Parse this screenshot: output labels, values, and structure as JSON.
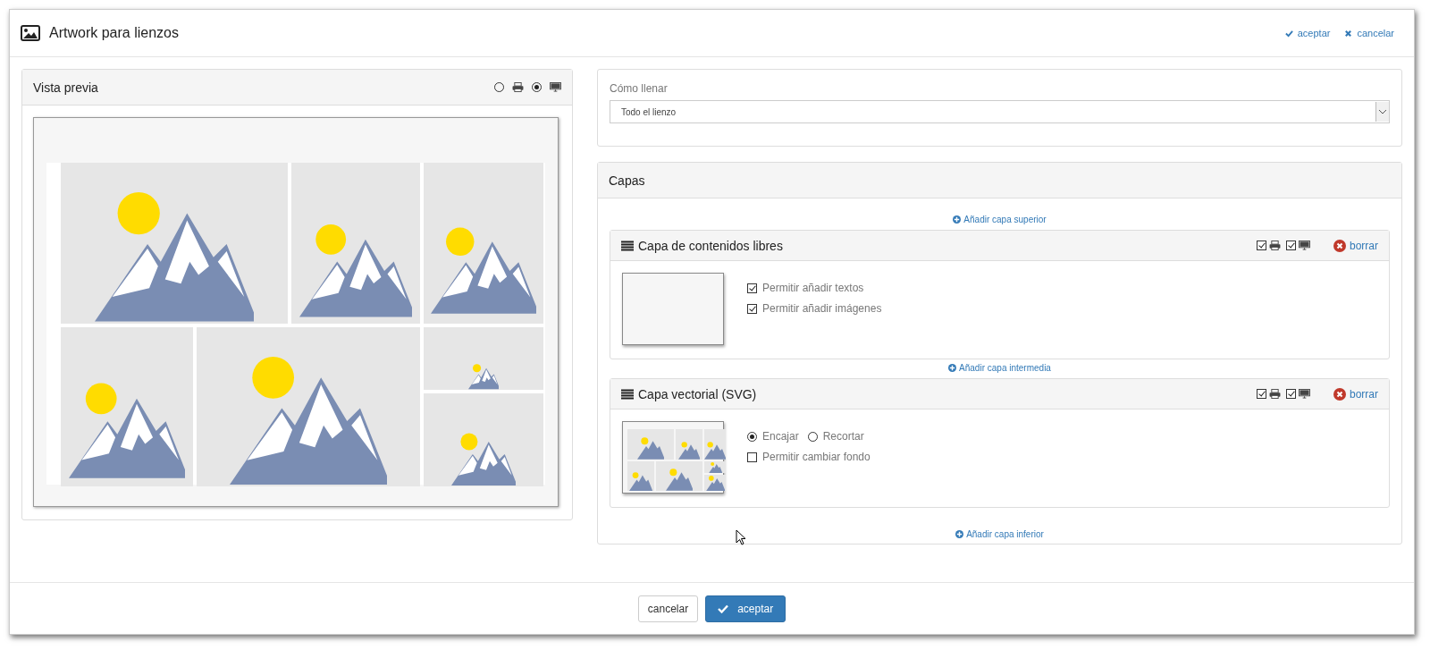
{
  "dialog": {
    "title": "Artwork para lienzos",
    "header_actions": [
      {
        "kind": "accept",
        "label": "aceptar"
      },
      {
        "kind": "cancel",
        "label": "cancelar"
      }
    ]
  },
  "preview": {
    "title": "Vista previa",
    "modes": [
      {
        "kind": "print",
        "selected": false
      },
      {
        "kind": "screen",
        "selected": true
      }
    ]
  },
  "fill": {
    "label": "Cómo llenar",
    "value": "Todo el lienzo"
  },
  "layers_panel": {
    "title": "Capas",
    "add_top": "Añadir capa superior",
    "add_middle": "Añadir capa intermedia",
    "add_bottom": "Añadir capa inferior",
    "layers": [
      {
        "kind": "content",
        "title": "Capa de contenidos libres",
        "print": true,
        "screen": true,
        "delete": "borrar",
        "options": [
          {
            "kind": "checkbox",
            "label": "Permitir añadir textos",
            "checked": true
          },
          {
            "kind": "checkbox",
            "label": "Permitir añadir imágenes",
            "checked": true
          }
        ]
      },
      {
        "kind": "vector",
        "title": "Capa vectorial (SVG)",
        "print": true,
        "screen": true,
        "delete": "borrar",
        "options": [
          {
            "kind": "radios",
            "items": [
              {
                "label": "Encajar",
                "selected": true
              },
              {
                "label": "Recortar",
                "selected": false
              }
            ]
          },
          {
            "kind": "checkbox",
            "label": "Permitir cambiar fondo",
            "checked": false
          }
        ]
      }
    ]
  },
  "footer": {
    "cancel": "cancelar",
    "accept": "aceptar"
  }
}
